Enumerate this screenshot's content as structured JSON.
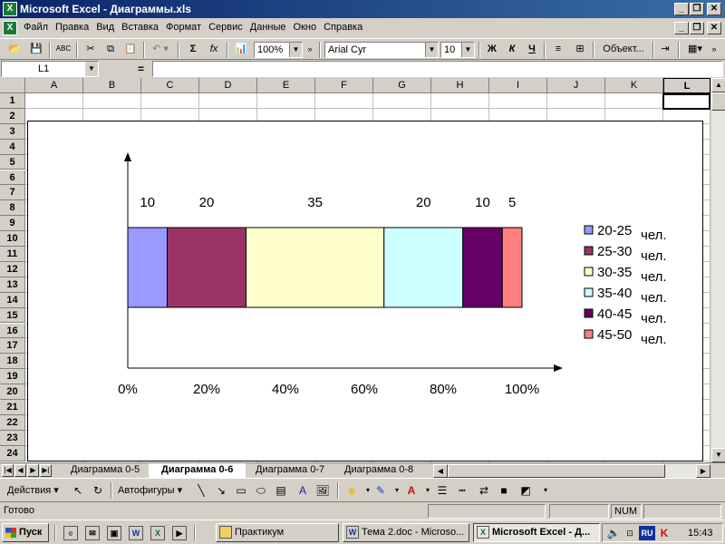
{
  "window": {
    "title": "Microsoft Excel - Диаграммы.xls",
    "app_icon": "excel-icon"
  },
  "menu": {
    "items": [
      "Файл",
      "Правка",
      "Вид",
      "Вставка",
      "Формат",
      "Сервис",
      "Данные",
      "Окно",
      "Справка"
    ]
  },
  "toolbar": {
    "zoom": "100%",
    "font": "Arial Cyr",
    "font_size": "10",
    "bold": "Ж",
    "italic": "К",
    "underline": "Ч",
    "objects_label": "Объект...",
    "sum_label": "Σ",
    "fx_label": "fx"
  },
  "formula_bar": {
    "name_box": "L1",
    "equals": "=",
    "value": ""
  },
  "sheet": {
    "columns": [
      "A",
      "B",
      "C",
      "D",
      "E",
      "F",
      "G",
      "H",
      "I",
      "J",
      "K",
      "L"
    ],
    "rows": [
      "1",
      "2",
      "3",
      "4",
      "5",
      "6",
      "7",
      "8",
      "9",
      "10",
      "11",
      "12",
      "13",
      "14",
      "15",
      "16",
      "17",
      "18",
      "19",
      "20",
      "21",
      "22",
      "23",
      "24"
    ],
    "selected_cell": "L1"
  },
  "chart_data": {
    "type": "bar",
    "orientation": "horizontal-stacked-100",
    "title": "",
    "xlabel": "",
    "ylabel": "",
    "x_ticks": [
      "0%",
      "20%",
      "40%",
      "60%",
      "80%",
      "100%"
    ],
    "xlim": [
      0,
      100
    ],
    "categories": [
      "20-25",
      "25-30",
      "30-35",
      "35-40",
      "40-45",
      "45-50"
    ],
    "values": [
      10,
      20,
      35,
      20,
      10,
      5
    ],
    "data_labels": [
      "10",
      "20",
      "35",
      "20",
      "10",
      "5"
    ],
    "colors": [
      "#9999ff",
      "#993366",
      "#ffffcc",
      "#ccffff",
      "#660066",
      "#ff8080"
    ],
    "legend": {
      "placement": "right",
      "entries": [
        "20-25",
        "25-30",
        "30-35",
        "35-40",
        "40-45",
        "45-50"
      ],
      "suffix": "чел."
    },
    "grid": false
  },
  "sheet_tabs": {
    "tabs": [
      "Диаграмма 0-5",
      "Диаграмма 0-6",
      "Диаграмма 0-7",
      "Диаграмма 0-8"
    ],
    "active": "Диаграмма 0-6"
  },
  "drawing_toolbar": {
    "actions_label": "Действия",
    "autoshapes_label": "Автофигуры"
  },
  "status": {
    "ready": "Готово",
    "num": "NUM"
  },
  "taskbar": {
    "start_label": "Пуск",
    "buttons": [
      "Практикум",
      "Тема 2.doc - Microso...",
      "Microsoft Excel - Д..."
    ],
    "lang": "RU",
    "time": "15:43"
  }
}
